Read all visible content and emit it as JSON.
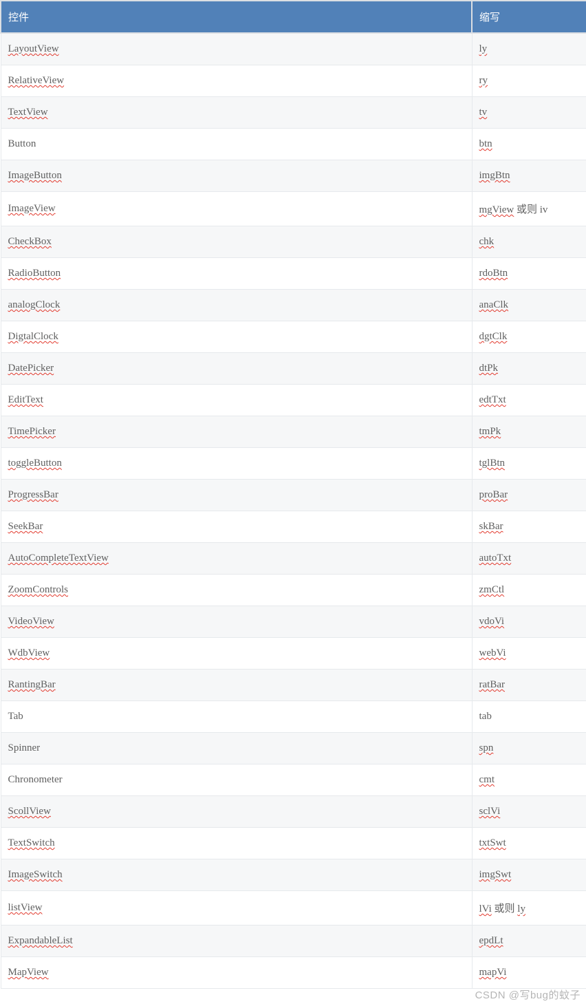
{
  "header": {
    "col1": "控件",
    "col2": "缩写"
  },
  "rows": [
    {
      "control": "LayoutView",
      "c_spell": true,
      "abbr": "ly",
      "a_spell": true,
      "suffix": ""
    },
    {
      "control": "RelativeView",
      "c_spell": true,
      "abbr": "ry",
      "a_spell": true,
      "suffix": ""
    },
    {
      "control": "TextView",
      "c_spell": true,
      "abbr": "tv",
      "a_spell": true,
      "suffix": ""
    },
    {
      "control": "Button",
      "c_spell": false,
      "abbr": "btn",
      "a_spell": true,
      "suffix": ""
    },
    {
      "control": "ImageButton",
      "c_spell": true,
      "abbr": "imgBtn",
      "a_spell": true,
      "suffix": ""
    },
    {
      "control": "ImageView",
      "c_spell": true,
      "abbr": "mgView",
      "a_spell": true,
      "suffix": " 或则 iv"
    },
    {
      "control": "CheckBox",
      "c_spell": true,
      "abbr": "chk",
      "a_spell": true,
      "suffix": ""
    },
    {
      "control": "RadioButton",
      "c_spell": true,
      "abbr": "rdoBtn",
      "a_spell": true,
      "suffix": ""
    },
    {
      "control": "analogClock",
      "c_spell": true,
      "abbr": "anaClk",
      "a_spell": true,
      "suffix": ""
    },
    {
      "control": "DigtalClock",
      "c_spell": true,
      "abbr": "dgtClk",
      "a_spell": true,
      "suffix": ""
    },
    {
      "control": "DatePicker",
      "c_spell": true,
      "abbr": "dtPk",
      "a_spell": true,
      "suffix": ""
    },
    {
      "control": "EditText",
      "c_spell": true,
      "abbr": "edtTxt",
      "a_spell": true,
      "suffix": ""
    },
    {
      "control": "TimePicker",
      "c_spell": true,
      "abbr": "tmPk",
      "a_spell": true,
      "suffix": ""
    },
    {
      "control": "toggleButton",
      "c_spell": true,
      "abbr": "tglBtn",
      "a_spell": true,
      "suffix": ""
    },
    {
      "control": "ProgressBar",
      "c_spell": true,
      "abbr": "proBar",
      "a_spell": true,
      "suffix": ""
    },
    {
      "control": "SeekBar",
      "c_spell": true,
      "abbr": "skBar",
      "a_spell": true,
      "suffix": ""
    },
    {
      "control": "AutoCompleteTextView",
      "c_spell": true,
      "abbr": "autoTxt",
      "a_spell": true,
      "suffix": ""
    },
    {
      "control": "ZoomControls",
      "c_spell": true,
      "abbr": "zmCtl",
      "a_spell": true,
      "suffix": ""
    },
    {
      "control": "VideoView",
      "c_spell": true,
      "abbr": "vdoVi",
      "a_spell": true,
      "suffix": ""
    },
    {
      "control": "WdbView",
      "c_spell": true,
      "abbr": "webVi",
      "a_spell": true,
      "suffix": ""
    },
    {
      "control": "RantingBar",
      "c_spell": true,
      "abbr": "ratBar",
      "a_spell": true,
      "suffix": ""
    },
    {
      "control": "Tab",
      "c_spell": false,
      "abbr": "tab",
      "a_spell": false,
      "suffix": ""
    },
    {
      "control": "Spinner",
      "c_spell": false,
      "abbr": "spn",
      "a_spell": true,
      "suffix": ""
    },
    {
      "control": "Chronometer",
      "c_spell": false,
      "abbr": "cmt",
      "a_spell": true,
      "suffix": ""
    },
    {
      "control": "ScollView",
      "c_spell": true,
      "abbr": "sclVi",
      "a_spell": true,
      "suffix": ""
    },
    {
      "control": "TextSwitch",
      "c_spell": true,
      "abbr": "txtSwt",
      "a_spell": true,
      "suffix": ""
    },
    {
      "control": "ImageSwitch",
      "c_spell": true,
      "abbr": "imgSwt",
      "a_spell": true,
      "suffix": ""
    },
    {
      "control": "listView",
      "c_spell": true,
      "abbr": "lVi",
      "a_spell": true,
      "suffix": " 或则 ",
      "abbr2": "ly",
      "a2_spell": true
    },
    {
      "control": "ExpandableList",
      "c_spell": true,
      "abbr": "epdLt",
      "a_spell": true,
      "suffix": ""
    },
    {
      "control": "MapView",
      "c_spell": true,
      "abbr": "mapVi",
      "a_spell": true,
      "suffix": ""
    }
  ],
  "watermark": "CSDN @写bug的蚊子"
}
